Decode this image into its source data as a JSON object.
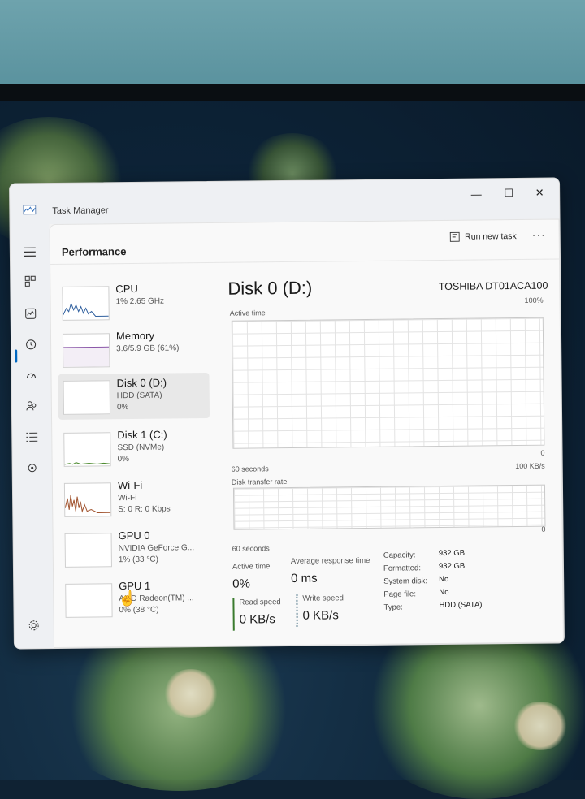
{
  "window": {
    "title": "Task Manager",
    "minimize": "—",
    "maximize": "☐",
    "close": "✕"
  },
  "nav": {
    "icons": [
      "hamburger-icon",
      "processes-icon",
      "performance-icon",
      "app-history-icon",
      "startup-apps-icon",
      "users-icon",
      "details-icon",
      "services-icon",
      "settings-icon"
    ]
  },
  "header": {
    "title": "Performance",
    "run_new_task": "Run new task",
    "more": "···"
  },
  "devices": [
    {
      "name": "CPU",
      "sub1": "1% 2.65 GHz",
      "sub2": ""
    },
    {
      "name": "Memory",
      "sub1": "3.6/5.9 GB (61%)",
      "sub2": ""
    },
    {
      "name": "Disk 0 (D:)",
      "sub1": "HDD (SATA)",
      "sub2": "0%"
    },
    {
      "name": "Disk 1 (C:)",
      "sub1": "SSD (NVMe)",
      "sub2": "0%"
    },
    {
      "name": "Wi-Fi",
      "sub1": "Wi-Fi",
      "sub2": "S: 0 R: 0 Kbps"
    },
    {
      "name": "GPU 0",
      "sub1": "NVIDIA GeForce G...",
      "sub2": "1% (33 °C)"
    },
    {
      "name": "GPU 1",
      "sub1": "AMD Radeon(TM) ...",
      "sub2": "0% (38 °C)"
    }
  ],
  "detail": {
    "title": "Disk 0 (D:)",
    "model": "TOSHIBA DT01ACA100",
    "active_time_label": "Active time",
    "active_time_max": "100%",
    "active_time_min": "0",
    "seconds_label_1": "60 seconds",
    "transfer_label": "Disk transfer rate",
    "transfer_max": "100 KB/s",
    "transfer_min": "0",
    "seconds_label_2": "60 seconds",
    "stats": {
      "active_time_lbl": "Active time",
      "active_time_val": "0%",
      "avg_resp_lbl": "Average response time",
      "avg_resp_val": "0 ms",
      "read_lbl": "Read speed",
      "read_val": "0 KB/s",
      "write_lbl": "Write speed",
      "write_val": "0 KB/s"
    },
    "props": [
      {
        "k": "Capacity:",
        "v": "932 GB"
      },
      {
        "k": "Formatted:",
        "v": "932 GB"
      },
      {
        "k": "System disk:",
        "v": "No"
      },
      {
        "k": "Page file:",
        "v": "No"
      },
      {
        "k": "Type:",
        "v": "HDD (SATA)"
      }
    ]
  },
  "colors": {
    "accent": "#0067c0",
    "cpu_graph": "#2f5f9e",
    "disk1_graph": "#4c8a2e",
    "wifi_graph": "#a0522d",
    "memory_graph": "#8a56a8"
  }
}
